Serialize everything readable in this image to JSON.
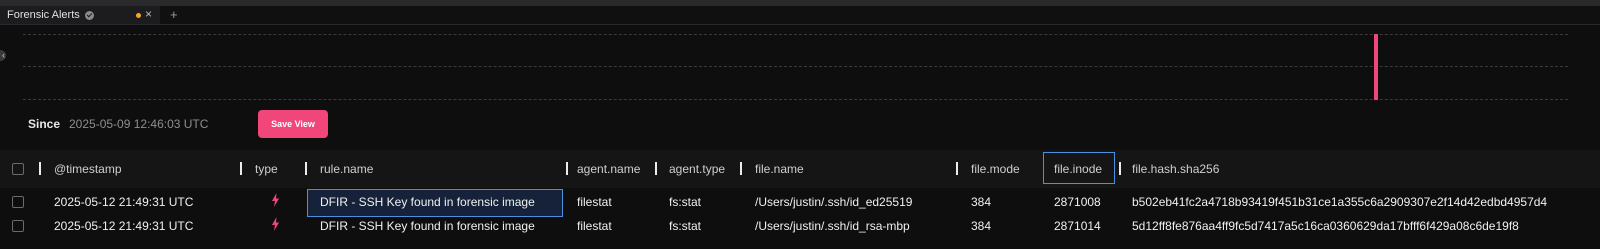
{
  "tab": {
    "title": "Forensic Alerts",
    "icons": [
      "verified-icon",
      "unsaved-dot-icon",
      "close-icon",
      "new-tab-icon"
    ],
    "new_tab_label": "+"
  },
  "histogram": {
    "spike_color": "#f0467a",
    "bars": [
      {
        "series": "alerts"
      }
    ]
  },
  "since": {
    "label": "Since",
    "value": "2025-05-09 12:46:03 UTC"
  },
  "save_view": {
    "label": "Save View"
  },
  "table": {
    "columns": [
      "@timestamp",
      "type",
      "rule.name",
      "agent.name",
      "agent.type",
      "file.name",
      "file.mode",
      "file.inode",
      "file.hash.sha256"
    ],
    "rows": [
      {
        "timestamp": "2025-05-12 21:49:31 UTC",
        "type_icon": "lightning-bolt-icon",
        "rule_name": "DFIR - SSH Key found in forensic image",
        "agent_name": "filestat",
        "agent_type": "fs:stat",
        "file_name": "/Users/justin/.ssh/id_ed25519",
        "file_mode": "384",
        "file_inode": "2871008",
        "file_hash": "b502eb41fc2a4718b93419f451b31ce1a355c6a2909307e2f14d42edbd4957d4"
      },
      {
        "timestamp": "2025-05-12 21:49:31 UTC",
        "type_icon": "lightning-bolt-icon",
        "rule_name": "DFIR - SSH Key found in forensic image",
        "agent_name": "filestat",
        "agent_type": "fs:stat",
        "file_name": "/Users/justin/.ssh/id_rsa-mbp",
        "file_mode": "384",
        "file_inode": "2871014",
        "file_hash": "5d12ff8fe876aa4ff9fc5d7417a5c16ca0360629da17bfff6f429a08c6de19f8"
      }
    ]
  },
  "colors": {
    "accent": "#f0467a",
    "selection": "#4a90e2",
    "unsaved_dot": "#f5a623",
    "background": "#0e0e0f"
  }
}
